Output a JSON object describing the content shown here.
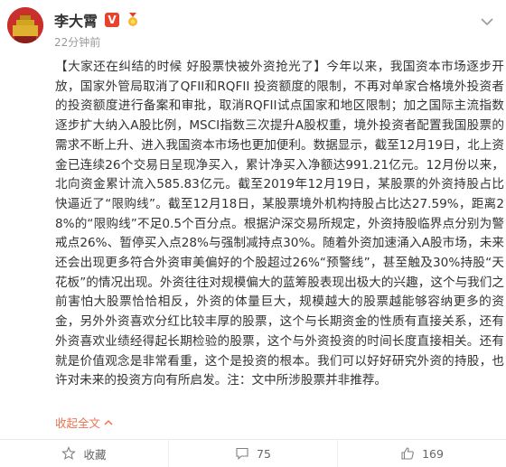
{
  "post": {
    "author": "李大霄",
    "time": "22分钟前",
    "verified_badge": "V",
    "content": "【大家还在纠结的时候 好股票快被外资抢光了】今年以来，我国资本市场逐步开放，国家外管局取消了QFII和RQFII 投资额度的限制，不再对单家合格境外投资者的投资额度进行备案和审批，取消RQFII试点国家和地区限制；加之国际主流指数逐步扩大纳入A股比例，MSCI指数三次提升A股权重，境外投资者配置我国股票的需求不断上升、进入我国资本市场也更加便利。数据显示，截至12月19日，北上资金已连续26个交易日呈现净买入，累计净买入净额达991.21亿元。12月份以来，北向资金累计流入585.83亿元。截至2019年12月19日，某股票的外资持股占比快逼近了“限购线”。截至12月18日，某股票境外机构持股占比达27.59%，距离28%的“限购线”不足0.5个百分点。根据沪深交易所规定，外资持股临界点分别为警戒点26%、暂停买入点28%与强制减持点30%。随着外资加速涌入A股市场，未来还会出现更多符合外资审美偏好的个股超过26%“预警线”，甚至触及30%持股“天花板”的情况出现。外资往往对规模偏大的蓝筹股表现出极大的兴趣，这个与我们之前害怕大股票恰恰相反，外资的体量巨大，规模越大的股票越能够容纳更多的资金，另外外资喜欢分红比较丰厚的股票，这个与长期资金的性质有直接关系，还有外资喜欢业绩经得起长期检验的股票，这个与外资投资的时间长度直接相关。还有就是价值观念是非常看重，这个是投资的根本。我们可以好好研究外资的持股，也许对未来的投资方向有所启发。注：文中所涉股票并非推荐。",
    "collapse_label": "收起全文"
  },
  "toolbar": {
    "favorite_label": "收藏",
    "comment_count": "75",
    "like_count": "169"
  },
  "colors": {
    "accent": "#eb7350",
    "badge": "#e8412c",
    "text": "#333333",
    "muted": "#9a9a9a"
  },
  "icons": {
    "avatar": "avatar-image",
    "verified": "verified-v-icon",
    "medal": "medal-icon",
    "dropdown": "chevron-down-icon",
    "collapse": "chevron-up-icon",
    "favorite": "star-icon",
    "comment": "comment-icon",
    "like": "thumb-up-icon"
  }
}
